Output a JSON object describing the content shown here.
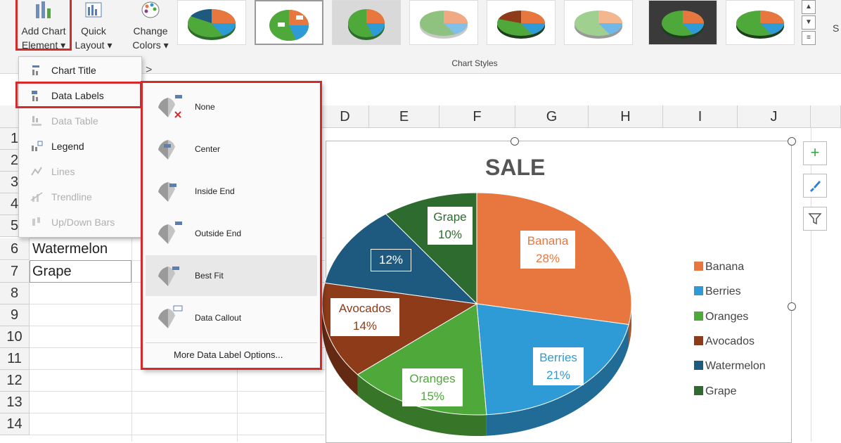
{
  "ribbon": {
    "add_chart_element": {
      "line1": "Add Chart",
      "line2": "Element ▾"
    },
    "quick_layout": {
      "line1": "Quick",
      "line2": "Layout ▾"
    },
    "change_colors": {
      "line1": "Change",
      "line2": "Colors ▾"
    },
    "chart_styles_label": "Chart Styles",
    "right_letter": "S"
  },
  "menu": {
    "items": [
      {
        "label": "Chart Title",
        "disabled": false
      },
      {
        "label": "Data Labels",
        "disabled": false
      },
      {
        "label": "Data Table",
        "disabled": true
      },
      {
        "label": "Legend",
        "disabled": false
      },
      {
        "label": "Lines",
        "disabled": true
      },
      {
        "label": "Trendline",
        "disabled": true
      },
      {
        "label": "Up/Down Bars",
        "disabled": true
      }
    ]
  },
  "submenu": {
    "items": [
      {
        "label": "None"
      },
      {
        "label": "Center"
      },
      {
        "label": "Inside End"
      },
      {
        "label": "Outside End"
      },
      {
        "label": "Best Fit"
      },
      {
        "label": "Data Callout"
      }
    ],
    "more_options": "More Data Label Options..."
  },
  "grid": {
    "columns": [
      "D",
      "E",
      "F",
      "G",
      "H",
      "I",
      "J"
    ],
    "rows": [
      "1",
      "2",
      "3",
      "4",
      "5",
      "6",
      "7",
      "8",
      "9",
      "10",
      "11",
      "12",
      "13",
      "14"
    ],
    "cells": {
      "row6": "Watermelon",
      "row7": "Grape"
    }
  },
  "chart_data": {
    "type": "pie",
    "title": "SALE",
    "categories": [
      "Banana",
      "Berries",
      "Oranges",
      "Avocados",
      "Watermelon",
      "Grape"
    ],
    "values": [
      28,
      21,
      15,
      14,
      12,
      10
    ],
    "labels": [
      "Banana\n28%",
      "Berries\n21%",
      "Oranges\n15%",
      "Avocados\n14%",
      "12%",
      "Grape\n10%"
    ],
    "colors": [
      "#e8773f",
      "#2e9ad6",
      "#4ea83a",
      "#8e3b1a",
      "#1e5a80",
      "#2e6b2e"
    ],
    "legend_position": "right"
  }
}
